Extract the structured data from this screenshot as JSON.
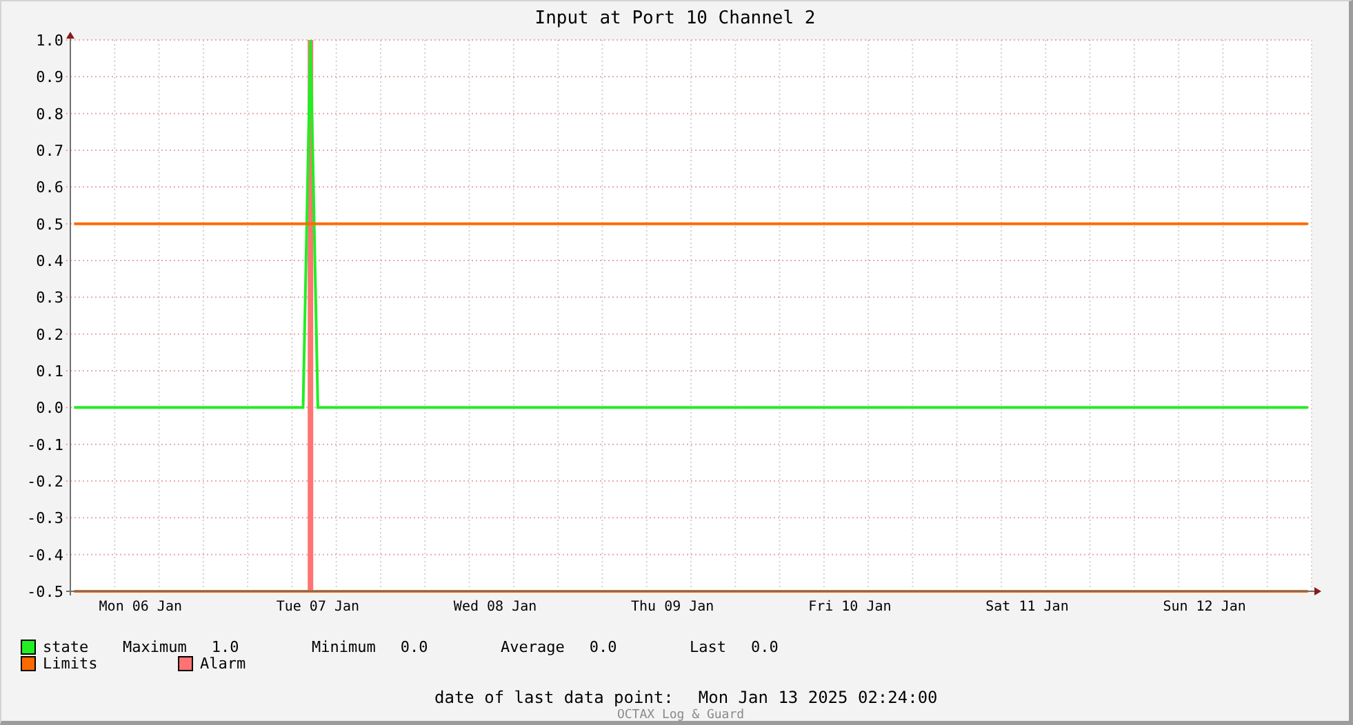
{
  "title": "Input at Port 10 Channel 2",
  "chart_data": {
    "type": "line",
    "grid": true,
    "ylim": [
      -0.5,
      1.0
    ],
    "categories": [
      null,
      null,
      null,
      null,
      null,
      null,
      null,
      null,
      null,
      "Mon 06 Jan",
      null,
      null,
      null,
      null,
      null,
      null,
      null,
      null,
      null,
      null,
      null,
      null,
      null,
      null,
      null,
      null,
      null,
      null,
      null,
      null,
      null,
      null,
      null,
      "Tue 07 Jan",
      null,
      null,
      null,
      null,
      null,
      null,
      null,
      null,
      null,
      null,
      null,
      null,
      null,
      null,
      null,
      null,
      null,
      null,
      null,
      null,
      null,
      null,
      null,
      "Wed 08 Jan",
      null,
      null,
      null,
      null,
      null,
      null,
      null,
      null,
      null,
      null,
      null,
      null,
      null,
      null,
      null,
      null,
      null,
      null,
      null,
      null,
      null,
      null,
      null,
      "Thu 09 Jan",
      null,
      null,
      null,
      null,
      null,
      null,
      null,
      null,
      null,
      null,
      null,
      null,
      null,
      null,
      null,
      null,
      null,
      null,
      null,
      null,
      null,
      null,
      null,
      "Fri 10 Jan",
      null,
      null,
      null,
      null,
      null,
      null,
      null,
      null,
      null,
      null,
      null,
      null,
      null,
      null,
      null,
      null,
      null,
      null,
      null,
      null,
      null,
      null,
      null,
      "Sat 11 Jan",
      null,
      null,
      null,
      null,
      null,
      null,
      null,
      null,
      null,
      null,
      null,
      null,
      null,
      null,
      null,
      null,
      null,
      null,
      null,
      null,
      null,
      null,
      null,
      "Sun 12 Jan",
      null,
      null,
      null,
      null,
      null,
      null,
      null,
      null,
      null,
      null,
      null,
      null,
      null,
      null
    ],
    "yticks": [
      {
        "value": 1.0,
        "label": "1.0"
      },
      {
        "value": 0.9,
        "label": "0.9"
      },
      {
        "value": 0.8,
        "label": "0.8"
      },
      {
        "value": 0.7,
        "label": "0.7"
      },
      {
        "value": 0.6,
        "label": "0.6"
      },
      {
        "value": 0.5,
        "label": "0.5"
      },
      {
        "value": 0.4,
        "label": "0.4"
      },
      {
        "value": 0.3,
        "label": "0.3"
      },
      {
        "value": 0.2,
        "label": "0.2"
      },
      {
        "value": 0.1,
        "label": "0.1"
      },
      {
        "value": 0.0,
        "label": "0.0"
      },
      {
        "value": -0.1,
        "label": "-0.1"
      },
      {
        "value": -0.2,
        "label": "-0.2"
      },
      {
        "value": -0.3,
        "label": "-0.3"
      },
      {
        "value": -0.4,
        "label": "-0.4"
      },
      {
        "value": -0.5,
        "label": "-0.5"
      }
    ],
    "series": [
      {
        "name": "state",
        "color": "#22ee22",
        "values": [
          0,
          0,
          0,
          0,
          0,
          0,
          0,
          0,
          0,
          0,
          0,
          0,
          0,
          0,
          0,
          0,
          0,
          0,
          0,
          0,
          0,
          0,
          0,
          0,
          0,
          0,
          0,
          0,
          0,
          0,
          0,
          0,
          1,
          0,
          0,
          0,
          0,
          0,
          0,
          0,
          0,
          0,
          0,
          0,
          0,
          0,
          0,
          0,
          0,
          0,
          0,
          0,
          0,
          0,
          0,
          0,
          0,
          0,
          0,
          0,
          0,
          0,
          0,
          0,
          0,
          0,
          0,
          0,
          0,
          0,
          0,
          0,
          0,
          0,
          0,
          0,
          0,
          0,
          0,
          0,
          0,
          0,
          0,
          0,
          0,
          0,
          0,
          0,
          0,
          0,
          0,
          0,
          0,
          0,
          0,
          0,
          0,
          0,
          0,
          0,
          0,
          0,
          0,
          0,
          0,
          0,
          0,
          0,
          0,
          0,
          0,
          0,
          0,
          0,
          0,
          0,
          0,
          0,
          0,
          0,
          0,
          0,
          0,
          0,
          0,
          0,
          0,
          0,
          0,
          0,
          0,
          0,
          0,
          0,
          0,
          0,
          0,
          0,
          0,
          0,
          0,
          0,
          0,
          0,
          0,
          0,
          0,
          0,
          0,
          0,
          0,
          0,
          0,
          0,
          0,
          0,
          0,
          0,
          0,
          0,
          0,
          0,
          0,
          0,
          0,
          0,
          0,
          0
        ]
      },
      {
        "name": "Limits",
        "color": "#ff6a00",
        "values": [
          0.5,
          0.5,
          0.5,
          0.5,
          0.5,
          0.5,
          0.5,
          0.5,
          0.5,
          0.5,
          0.5,
          0.5,
          0.5,
          0.5,
          0.5,
          0.5,
          0.5,
          0.5,
          0.5,
          0.5,
          0.5,
          0.5,
          0.5,
          0.5,
          0.5,
          0.5,
          0.5,
          0.5,
          0.5,
          0.5,
          0.5,
          0.5,
          0.5,
          0.5,
          0.5,
          0.5,
          0.5,
          0.5,
          0.5,
          0.5,
          0.5,
          0.5,
          0.5,
          0.5,
          0.5,
          0.5,
          0.5,
          0.5,
          0.5,
          0.5,
          0.5,
          0.5,
          0.5,
          0.5,
          0.5,
          0.5,
          0.5,
          0.5,
          0.5,
          0.5,
          0.5,
          0.5,
          0.5,
          0.5,
          0.5,
          0.5,
          0.5,
          0.5,
          0.5,
          0.5,
          0.5,
          0.5,
          0.5,
          0.5,
          0.5,
          0.5,
          0.5,
          0.5,
          0.5,
          0.5,
          0.5,
          0.5,
          0.5,
          0.5,
          0.5,
          0.5,
          0.5,
          0.5,
          0.5,
          0.5,
          0.5,
          0.5,
          0.5,
          0.5,
          0.5,
          0.5,
          0.5,
          0.5,
          0.5,
          0.5,
          0.5,
          0.5,
          0.5,
          0.5,
          0.5,
          0.5,
          0.5,
          0.5,
          0.5,
          0.5,
          0.5,
          0.5,
          0.5,
          0.5,
          0.5,
          0.5,
          0.5,
          0.5,
          0.5,
          0.5,
          0.5,
          0.5,
          0.5,
          0.5,
          0.5,
          0.5,
          0.5,
          0.5,
          0.5,
          0.5,
          0.5,
          0.5,
          0.5,
          0.5,
          0.5,
          0.5,
          0.5,
          0.5,
          0.5,
          0.5,
          0.5,
          0.5,
          0.5,
          0.5,
          0.5,
          0.5,
          0.5,
          0.5,
          0.5,
          0.5,
          0.5,
          0.5,
          0.5,
          0.5,
          0.5,
          0.5,
          0.5,
          0.5,
          0.5,
          0.5,
          0.5,
          0.5,
          0.5,
          0.5,
          0.5,
          0.5,
          0.5,
          0.5
        ]
      },
      {
        "color": "#ff6a00",
        "values": [
          -0.5,
          -0.5,
          -0.5,
          -0.5,
          -0.5,
          -0.5,
          -0.5,
          -0.5,
          -0.5,
          -0.5,
          -0.5,
          -0.5,
          -0.5,
          -0.5,
          -0.5,
          -0.5,
          -0.5,
          -0.5,
          -0.5,
          -0.5,
          -0.5,
          -0.5,
          -0.5,
          -0.5,
          -0.5,
          -0.5,
          -0.5,
          -0.5,
          -0.5,
          -0.5,
          -0.5,
          -0.5,
          -0.5,
          -0.5,
          -0.5,
          -0.5,
          -0.5,
          -0.5,
          -0.5,
          -0.5,
          -0.5,
          -0.5,
          -0.5,
          -0.5,
          -0.5,
          -0.5,
          -0.5,
          -0.5,
          -0.5,
          -0.5,
          -0.5,
          -0.5,
          -0.5,
          -0.5,
          -0.5,
          -0.5,
          -0.5,
          -0.5,
          -0.5,
          -0.5,
          -0.5,
          -0.5,
          -0.5,
          -0.5,
          -0.5,
          -0.5,
          -0.5,
          -0.5,
          -0.5,
          -0.5,
          -0.5,
          -0.5,
          -0.5,
          -0.5,
          -0.5,
          -0.5,
          -0.5,
          -0.5,
          -0.5,
          -0.5,
          -0.5,
          -0.5,
          -0.5,
          -0.5,
          -0.5,
          -0.5,
          -0.5,
          -0.5,
          -0.5,
          -0.5,
          -0.5,
          -0.5,
          -0.5,
          -0.5,
          -0.5,
          -0.5,
          -0.5,
          -0.5,
          -0.5,
          -0.5,
          -0.5,
          -0.5,
          -0.5,
          -0.5,
          -0.5,
          -0.5,
          -0.5,
          -0.5,
          -0.5,
          -0.5,
          -0.5,
          -0.5,
          -0.5,
          -0.5,
          -0.5,
          -0.5,
          -0.5,
          -0.5,
          -0.5,
          -0.5,
          -0.5,
          -0.5,
          -0.5,
          -0.5,
          -0.5,
          -0.5,
          -0.5,
          -0.5,
          -0.5,
          -0.5,
          -0.5,
          -0.5,
          -0.5,
          -0.5,
          -0.5,
          -0.5,
          -0.5,
          -0.5,
          -0.5,
          -0.5,
          -0.5,
          -0.5,
          -0.5,
          -0.5,
          -0.5,
          -0.5,
          -0.5,
          -0.5,
          -0.5,
          -0.5,
          -0.5,
          -0.5,
          -0.5,
          -0.5,
          -0.5,
          -0.5,
          -0.5,
          -0.5,
          -0.5,
          -0.5,
          -0.5,
          -0.5,
          -0.5,
          -0.5,
          -0.5,
          -0.5,
          -0.5,
          -0.5
        ]
      }
    ]
  },
  "alarm": {
    "label": "Alarm",
    "color": "#ff7373"
  },
  "stats": [
    {
      "label": "Maximum",
      "value": "1.0"
    },
    {
      "label": "Minimum",
      "value": "0.0"
    },
    {
      "label": "Average",
      "value": "0.0"
    },
    {
      "label": "Last",
      "value": "0.0"
    }
  ],
  "footer": {
    "label": "date of last data point:",
    "value": "Mon Jan 13 2025 02:24:00"
  },
  "credit": "OCTAX Log & Guard"
}
